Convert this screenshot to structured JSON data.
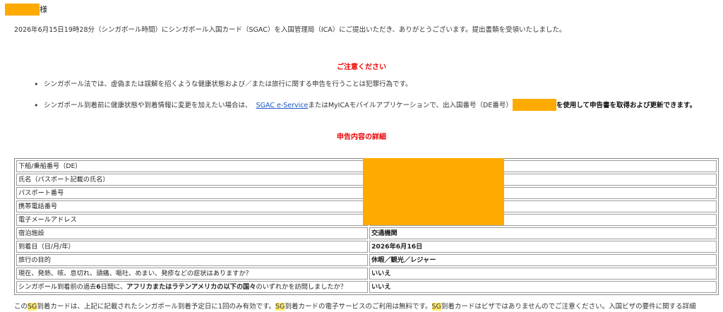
{
  "greeting": {
    "honorific": "様"
  },
  "confirmation": "2026年6月15日19時28分（シンガポール時間）にシンガポール入国カード（SGAC）を入国管理局（ICA）にご提出いただき、ありがとうございます。提出書類を受領いたしました。",
  "notice": {
    "heading": "ご注意ください",
    "bullets": [
      {
        "text": "シンガポール法では、虚偽または誤解を招くような健康状態および／または旅行に関する申告を行うことは犯罪行為です。"
      },
      {
        "before": "シンガポール到着前に健康状態や到着情報に変更を加えたい場合は、",
        "link": "SGAC e-Service",
        "middle": "またはMyICAモバイルアプリケーションで、出入国番号（DE番号）",
        "after": "を使用して申告書を取得および更新できます。"
      }
    ]
  },
  "details": {
    "heading": "申告内容の詳細",
    "rows": [
      {
        "label": "下船/乗船番号（DE）",
        "value": ""
      },
      {
        "label": "氏名（パスポート記載の氏名）",
        "value": ""
      },
      {
        "label": "パスポート番号",
        "value": ""
      },
      {
        "label": "携帯電話番号",
        "value": ""
      },
      {
        "label": "電子メールアドレス",
        "value": ""
      },
      {
        "label": "宿泊施設",
        "value": "交通機関"
      },
      {
        "label": "到着日（日/月/年）",
        "value": "2026年6月16日"
      },
      {
        "label": "旅行の目的",
        "value": "休暇／観光／レジャー"
      },
      {
        "label": "現在、発熱、咳、息切れ、頭痛、嘔吐、めまい、発疹などの症状はありますか？",
        "value": "いいえ"
      },
      {
        "label_before": "シンガポール到着前の過去",
        "label_strong1": "6",
        "label_mid": "日間に、",
        "label_strong2": "アフリカまたはラテンアメリカの以下の国々",
        "label_after": "のいずれかを訪問しましたか？",
        "value": "いいえ"
      }
    ]
  },
  "footer": {
    "p1": "この",
    "sg": "SG",
    "p2": "到着カードは、上記に記載されたシンガポール到着予定日に1回のみ有効です。",
    "p3": "到着カードの電子サービスのご利用は無料です。",
    "p4": "到着カードはビザではありませんのでご注意ください。入国ビザの要件に関する詳細"
  },
  "colors": {
    "redaction": "#FFAA00",
    "heading": "#EE0000",
    "link": "#1a56c4",
    "highlight": "#FFE96B"
  }
}
